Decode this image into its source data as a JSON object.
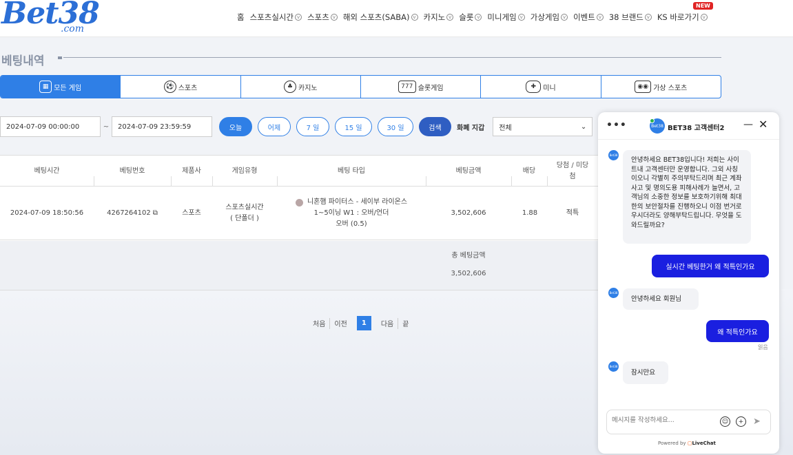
{
  "header": {
    "logo_text": "Bet38",
    "logo_sub": ".com",
    "new_badge": "NEW",
    "nav": [
      "홈",
      "스포츠실시간",
      "스포츠",
      "해외 스포츠(SABA)",
      "카지노",
      "슬롯",
      "미니게임",
      "가상게임",
      "이벤트",
      "38 브랜드",
      "KS 바로가기"
    ]
  },
  "page": {
    "title": "베팅내역"
  },
  "tabs": [
    {
      "label": "모든 게임",
      "icon": "grid-icon",
      "active": true
    },
    {
      "label": "스포츠",
      "icon": "soccer-ball-icon"
    },
    {
      "label": "카지노",
      "icon": "casino-chip-icon"
    },
    {
      "label": "슬롯게임",
      "icon": "slot-machine-icon"
    },
    {
      "label": "미니",
      "icon": "gamepad-icon"
    },
    {
      "label": "가상 스포츠",
      "icon": "virtual-sports-icon"
    }
  ],
  "filters": {
    "date_from": "2024-07-09 00:00:00",
    "tilde": "~",
    "date_to": "2024-07-09 23:59:59",
    "ranges": [
      "오늘",
      "어제",
      "7 일",
      "15 일",
      "30 일"
    ],
    "search": "검색",
    "currency_label": "화폐 지갑",
    "currency_value": "전체"
  },
  "table": {
    "headers": [
      "베팅시간",
      "베팅번호",
      "제품사",
      "게임유형",
      "베팅 타입",
      "베팅금액",
      "배당",
      "당첨 / 미당첨"
    ],
    "row": {
      "time": "2024-07-09 18:50:56",
      "number": "4267264102",
      "provider": "스포츠",
      "game_type_1": "스포츠실시간",
      "game_type_2": "( 단폴더 )",
      "bet_line1": "니혼햄 파이터스 - 세이부 라이온스",
      "bet_line2": "1~5이닝 W1 : 오버/언더",
      "bet_line3": "오버 (0.5)",
      "amount": "3,502,606",
      "odds": "1.88",
      "result": "적특"
    },
    "total_label": "총 베팅금액",
    "total_value": "3,502,606"
  },
  "pager": {
    "first": "처음",
    "prev": "이전",
    "current": "1",
    "next": "다음",
    "last": "끝"
  },
  "chat": {
    "menu": "•••",
    "title": "BET38 고객센터2",
    "min": "—",
    "close": "✕",
    "avatar_text": "Bet38",
    "msg1": "안녕하세요 BET38입니다! 저희는 사이트내 고객센터만 운영합니다. 그외 사칭이오니 각별히 주의부탁드리며 최근 계좌사고 및 명의도용 피해사례가 늘면서, 고객님의 소중한 정보를 보호하기위해 최대한의 보안절차를 진행하오니 이점 번거로우시더라도 양해부탁드립니다. 무엇을 도와드릴까요?",
    "out1": "실시간 베팅한거 왜 적특인가요",
    "msg2": "안녕하세요 회원님",
    "out2": "왜 적특인가요",
    "read": "읽음",
    "msg3": "잠시만요",
    "placeholder": "메시지를 작성하세요...",
    "powered_prefix": "Powered by",
    "powered_brand": "LiveChat"
  }
}
